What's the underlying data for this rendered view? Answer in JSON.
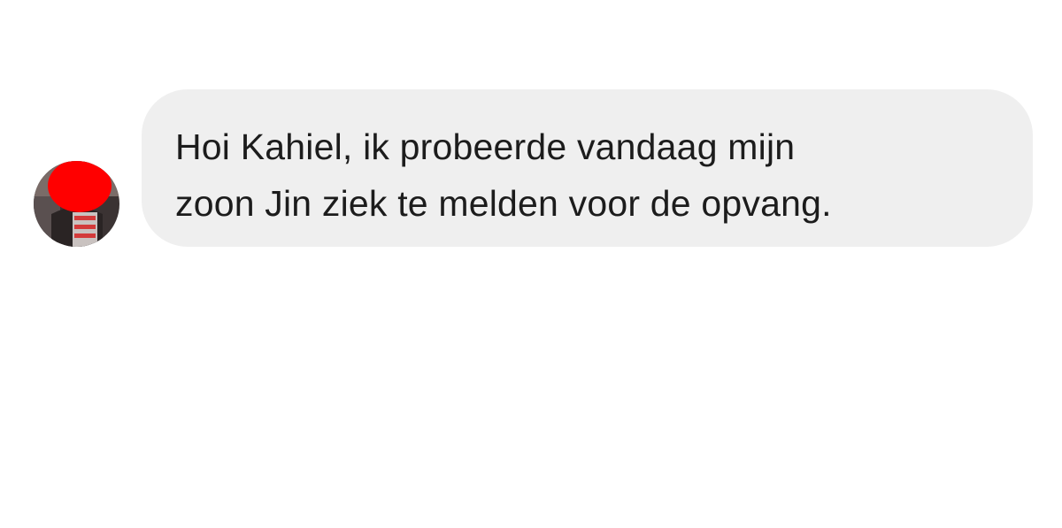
{
  "conversation": {
    "message": {
      "lines": [
        "Hoi Kahiel, ik probeerde vandaag mijn",
        "zoon Jin ziek te melden voor de opvang."
      ]
    },
    "avatar": {
      "redaction_color": "#ff0000"
    },
    "colors": {
      "bubble_background": "#efefef",
      "text": "#1c1c1c",
      "page_background": "#ffffff"
    }
  }
}
